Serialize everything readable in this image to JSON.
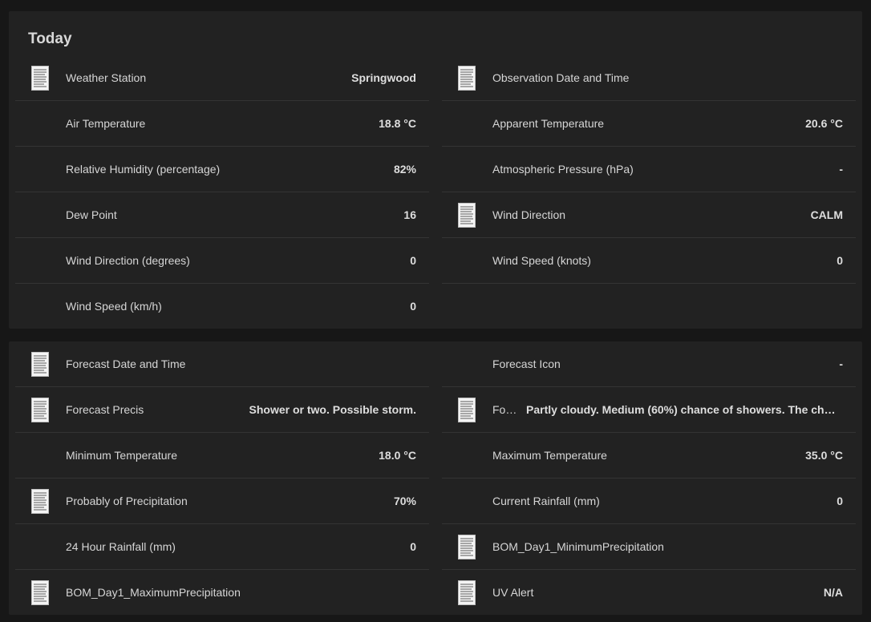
{
  "today": {
    "title": "Today",
    "left": [
      {
        "label": "Weather Station",
        "value": "Springwood",
        "icon": "document-icon"
      },
      {
        "label": "Air Temperature",
        "value": "18.8 °C"
      },
      {
        "label": "Relative Humidity (percentage)",
        "value": "82%"
      },
      {
        "label": "Dew Point",
        "value": "16"
      },
      {
        "label": "Wind Direction (degrees)",
        "value": "0"
      },
      {
        "label": "Wind Speed (km/h)",
        "value": "0"
      }
    ],
    "right": [
      {
        "label": "Observation Date and Time",
        "value": "",
        "icon": "document-icon"
      },
      {
        "label": "Apparent Temperature",
        "value": "20.6 °C"
      },
      {
        "label": "Atmospheric Pressure (hPa)",
        "value": "-"
      },
      {
        "label": "Wind Direction",
        "value": "CALM",
        "icon": "document-icon"
      },
      {
        "label": "Wind Speed (knots)",
        "value": "0"
      }
    ]
  },
  "forecast": {
    "left": [
      {
        "label": "Forecast Date and Time",
        "value": "",
        "icon": "document-icon"
      },
      {
        "label": "Forecast Precis",
        "value": "Shower or two. Possible storm.",
        "icon": "document-icon"
      },
      {
        "label": "Minimum Temperature",
        "value": "18.0 °C"
      },
      {
        "label": "Probably of Precipitation",
        "value": "70%",
        "icon": "document-icon"
      },
      {
        "label": "24 Hour Rainfall (mm)",
        "value": "0"
      },
      {
        "label": "BOM_Day1_MaximumPrecipitation",
        "value": "",
        "icon": "document-icon"
      }
    ],
    "right": [
      {
        "label": "Forecast Icon",
        "value": "-"
      },
      {
        "label": "For…",
        "value": "Partly cloudy. Medium (60%) chance of showers. The cha…",
        "icon": "document-icon"
      },
      {
        "label": "Maximum Temperature",
        "value": "35.0 °C"
      },
      {
        "label": "Current Rainfall (mm)",
        "value": "0"
      },
      {
        "label": "BOM_Day1_MinimumPrecipitation",
        "value": "",
        "icon": "document-icon"
      },
      {
        "label": "UV Alert",
        "value": "N/A",
        "icon": "document-icon"
      }
    ]
  }
}
